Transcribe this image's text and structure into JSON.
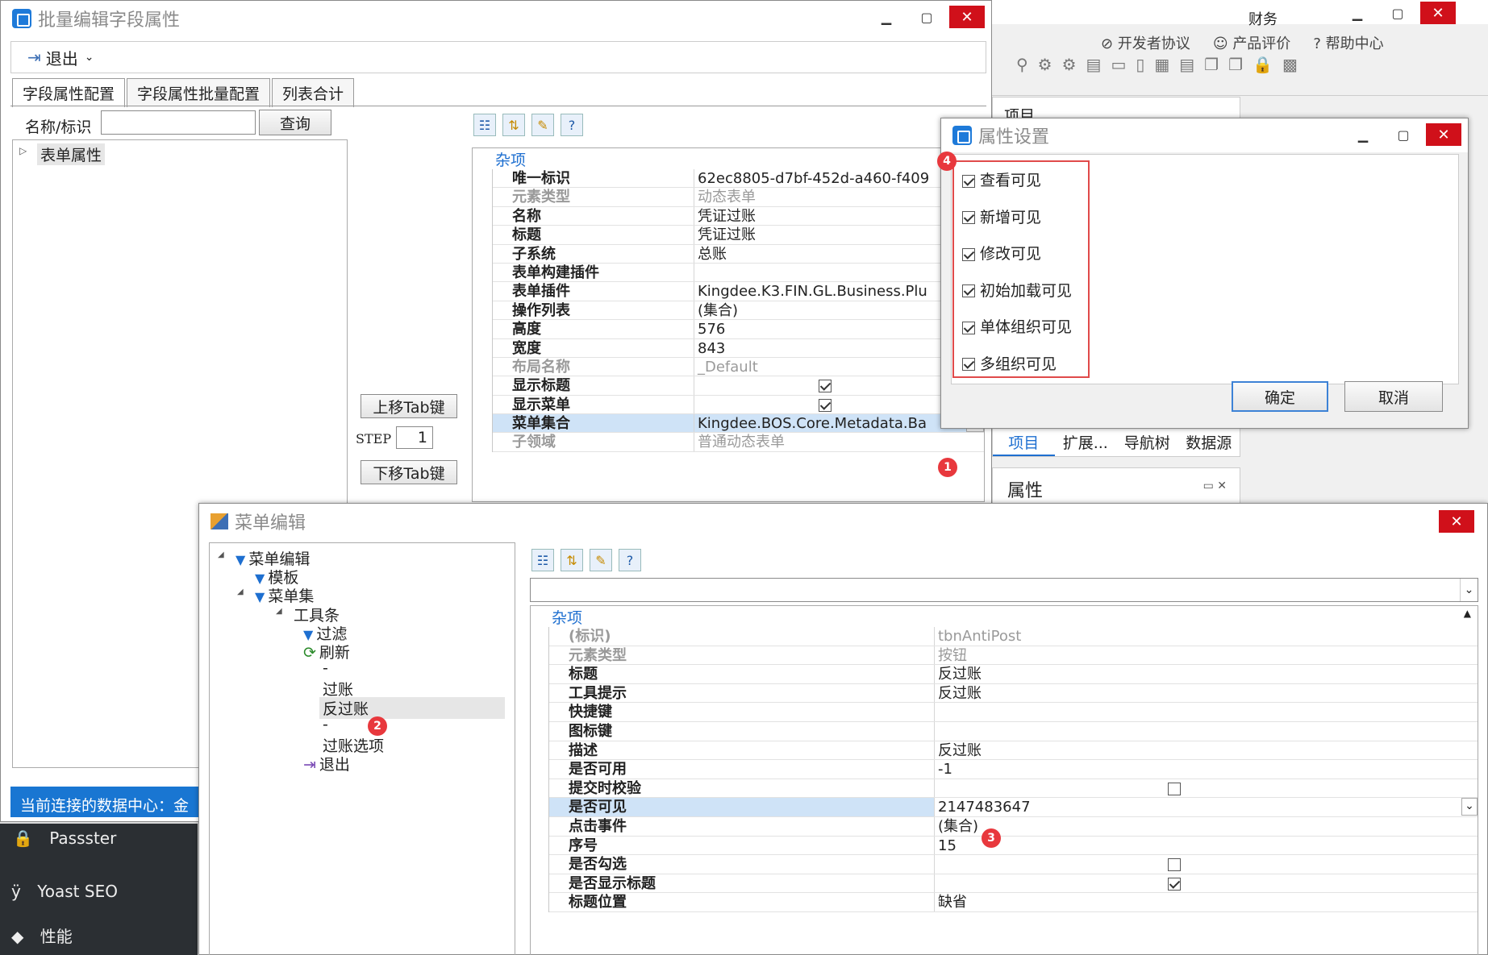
{
  "win_main": {
    "title": "批量编辑字段属性",
    "exit_label": "退出",
    "tabs": [
      "字段属性配置",
      "字段属性批量配置",
      "列表合计"
    ],
    "search_label": "名称/标识",
    "search_value": "",
    "query_btn": "查询",
    "tree_root": "表单属性",
    "up_tab_btn": "上移Tab键",
    "down_tab_btn": "下移Tab键",
    "step_label": "STEP",
    "step_value": "1",
    "section": "杂项",
    "props": [
      {
        "k": "唯一标识",
        "v": "62ec8805-d7bf-452d-a460-f409"
      },
      {
        "k": "元素类型",
        "v": "动态表单",
        "dis": true
      },
      {
        "k": "名称",
        "v": "凭证过账"
      },
      {
        "k": "标题",
        "v": "凭证过账"
      },
      {
        "k": "子系统",
        "v": "总账"
      },
      {
        "k": "表单构建插件",
        "v": ""
      },
      {
        "k": "表单插件",
        "v": "Kingdee.K3.FIN.GL.Business.Plu"
      },
      {
        "k": "操作列表",
        "v": "(集合)"
      },
      {
        "k": "高度",
        "v": "576"
      },
      {
        "k": "宽度",
        "v": "843"
      },
      {
        "k": "布局名称",
        "v": "_Default",
        "dis": true
      },
      {
        "k": "显示标题",
        "v": "",
        "check": true
      },
      {
        "k": "显示菜单",
        "v": "",
        "check": true
      },
      {
        "k": "菜单集合",
        "v": "Kingdee.BOS.Core.Metadata.Ba",
        "sel": true
      },
      {
        "k": "子领域",
        "v": "普通动态表单",
        "dis": true
      }
    ],
    "status": "当前连接的数据中心：金"
  },
  "right_bg": {
    "links": [
      "开发者协议",
      "产品评价",
      "帮助中心"
    ],
    "tabs": [
      "项目",
      "扩展...",
      "导航树",
      "数据源"
    ],
    "panel_title": "属性",
    "item_label": "项目",
    "right_text": "财务"
  },
  "attr_dlg": {
    "title": "属性设置",
    "options": [
      "查看可见",
      "新增可见",
      "修改可见",
      "初始加载可见",
      "单体组织可见",
      "多组织可见"
    ],
    "ok": "确定",
    "cancel": "取消"
  },
  "menu_win": {
    "title": "菜单编辑",
    "tree": [
      "菜单编辑",
      "模板",
      "菜单集",
      "工具条",
      "过滤",
      "刷新",
      "-",
      "过账",
      "反过账",
      "-",
      "过账选项",
      "退出"
    ],
    "section": "杂项",
    "props": [
      {
        "k": "(标识)",
        "v": "tbnAntiPost",
        "dis": true
      },
      {
        "k": "元素类型",
        "v": "按钮",
        "dis": true
      },
      {
        "k": "标题",
        "v": "反过账"
      },
      {
        "k": "工具提示",
        "v": "反过账"
      },
      {
        "k": "快捷键",
        "v": ""
      },
      {
        "k": "图标键",
        "v": ""
      },
      {
        "k": "描述",
        "v": "反过账"
      },
      {
        "k": "是否可用",
        "v": "-1"
      },
      {
        "k": "提交时校验",
        "v": "",
        "check": false
      },
      {
        "k": "是否可见",
        "v": "2147483647",
        "sel": true
      },
      {
        "k": "点击事件",
        "v": "(集合)"
      },
      {
        "k": "序号",
        "v": "15"
      },
      {
        "k": "是否勾选",
        "v": "",
        "check": false
      },
      {
        "k": "是否显示标题",
        "v": "",
        "check": true
      },
      {
        "k": "标题位置",
        "v": "缺省"
      }
    ]
  },
  "wp_menu": [
    "Passster",
    "Yoast SEO",
    "性能"
  ],
  "badges": [
    "1",
    "2",
    "3",
    "4"
  ]
}
